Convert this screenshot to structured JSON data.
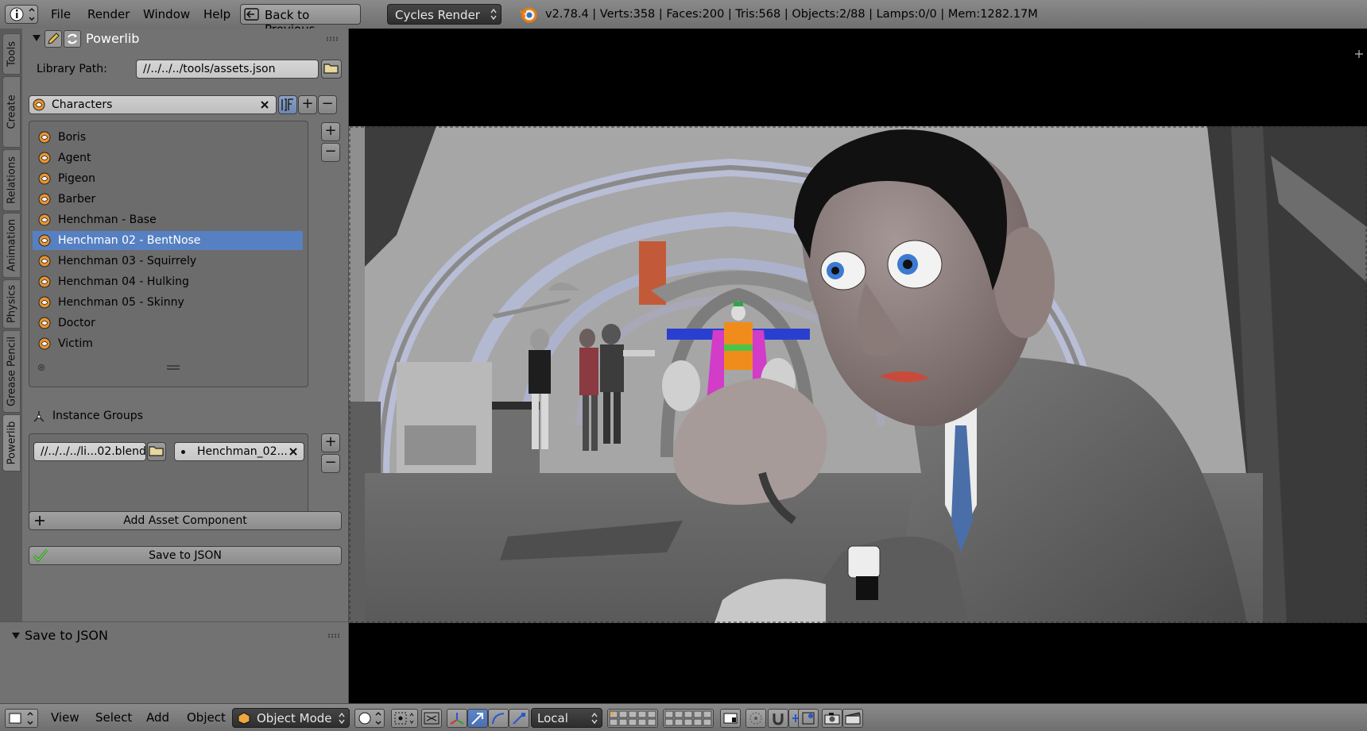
{
  "top_bar": {
    "menus": [
      "File",
      "Render",
      "Window",
      "Help"
    ],
    "back_button_label": "Back to Previous",
    "render_engine": "Cycles Render",
    "stats": "v2.78.4 | Verts:358 | Faces:200 | Tris:568 | Objects:2/88 | Lamps:0/0 | Mem:1282.17M"
  },
  "tabs": [
    "Tools",
    "Create",
    "Relations",
    "Animation",
    "Physics",
    "Grease Pencil",
    "Powerlib"
  ],
  "active_tab": "Powerlib",
  "powerlib": {
    "title": "Powerlib",
    "library_path_label": "Library Path:",
    "library_path_value": "//../../../tools/assets.json",
    "category": "Characters",
    "characters": [
      "Boris",
      "Agent",
      "Pigeon",
      "Barber",
      "Henchman - Base",
      "Henchman 02 - BentNose",
      "Henchman 03 - Squirrely",
      "Henchman 04 - Hulking",
      "Henchman 05 - Skinny",
      "Doctor",
      "Victim"
    ],
    "selected_character": "Henchman 02 - BentNose",
    "instance_groups_label": "Instance Groups",
    "instance_group_file": "//../../../li...02.blend",
    "instance_group_name": "Henchman_02...",
    "add_asset_label": "Add Asset Component",
    "save_json_label": "Save to JSON"
  },
  "operator_panel": {
    "title": "Save to JSON"
  },
  "bottom_bar": {
    "menus": [
      "View",
      "Select",
      "Add",
      "Object"
    ],
    "mode": "Object Mode",
    "pivot": "Local"
  },
  "colors": {
    "selection": "#5680c2",
    "panel": "#727272",
    "header": "#7d7d7d",
    "viewport_letterbox": "#000000"
  }
}
